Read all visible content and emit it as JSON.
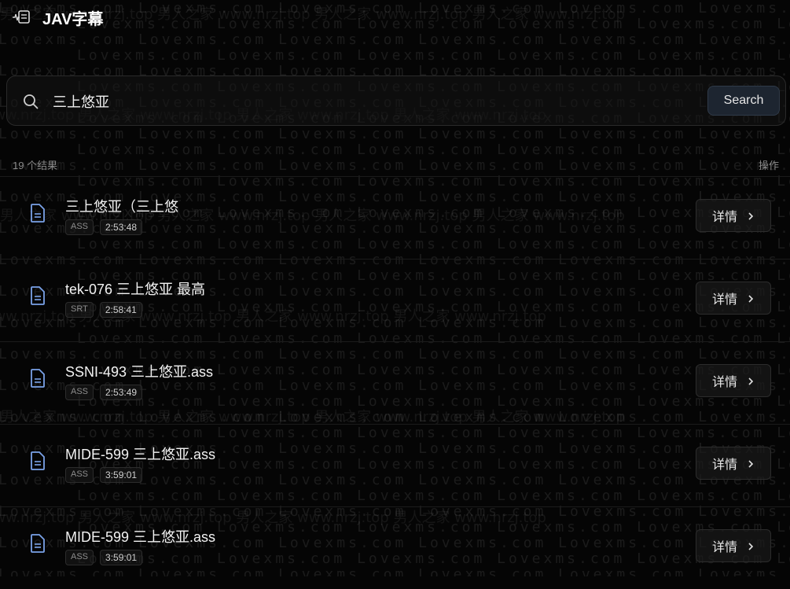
{
  "app": {
    "title": "JAV字幕"
  },
  "watermarks": {
    "main": "Lovexms.com",
    "secondary": "男人之家 www.nrzj.top"
  },
  "search": {
    "value": "三上悠亚",
    "button_label": "Search"
  },
  "results_meta": {
    "count_label": "19 个结果",
    "actions_label": "操作"
  },
  "results": [
    {
      "title": "三上悠亚（三上悠",
      "format": "ASS",
      "duration": "2:53:48",
      "detail_label": "详情"
    },
    {
      "title": "tek-076 三上悠亚 最高",
      "format": "SRT",
      "duration": "2:58:41",
      "detail_label": "详情"
    },
    {
      "title": "SSNI-493 三上悠亚.ass",
      "format": "ASS",
      "duration": "2:53:49",
      "detail_label": "详情"
    },
    {
      "title": "MIDE-599 三上悠亚.ass",
      "format": "ASS",
      "duration": "3:59:01",
      "detail_label": "详情"
    },
    {
      "title": "MIDE-599 三上悠亚.ass",
      "format": "ASS",
      "duration": "3:59:01",
      "detail_label": "详情"
    }
  ],
  "icons": {
    "logo": "subtitle-waveform-icon",
    "search": "search-icon",
    "file": "document-icon",
    "chevron": "chevron-right-icon"
  },
  "colors": {
    "background": "#050505",
    "accent_icon": "#7aa2e8",
    "button_bg": "#1d2530"
  }
}
